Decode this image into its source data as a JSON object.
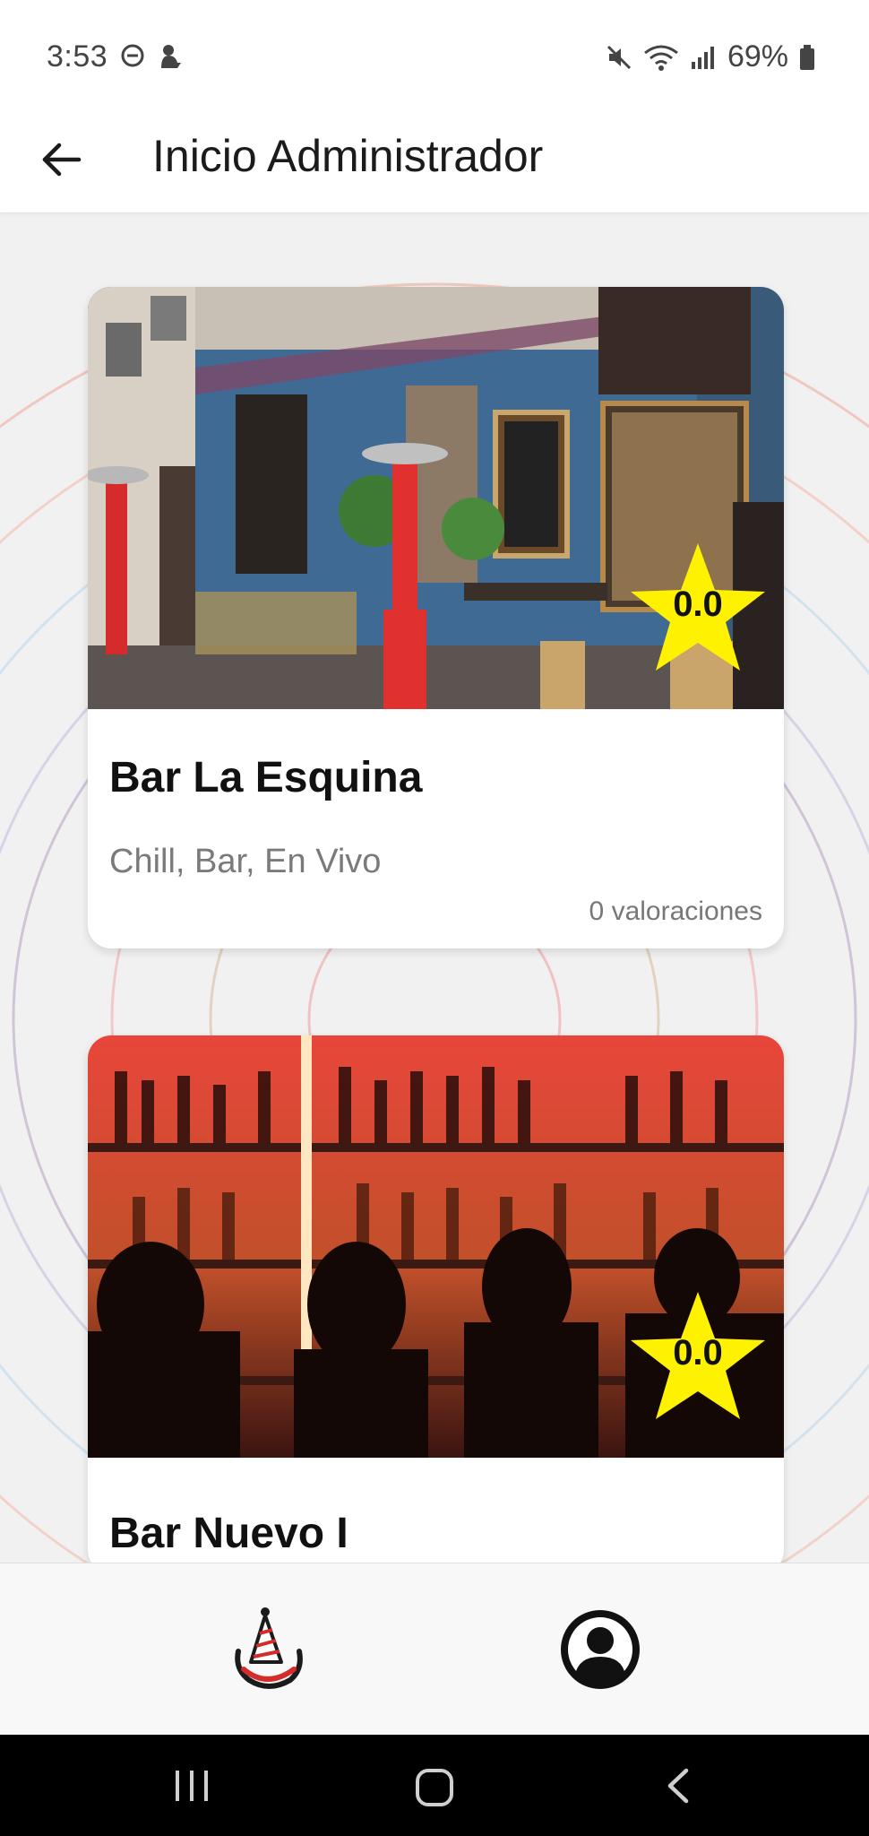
{
  "status_bar": {
    "time": "3:53",
    "battery": "69%",
    "icons": [
      "dnd-icon",
      "notification-icon",
      "mute-icon",
      "wifi-icon",
      "signal-icon",
      "battery-icon"
    ]
  },
  "app_bar": {
    "title": "Inicio Administrador",
    "back_icon": "arrow-left-icon"
  },
  "venues": [
    {
      "name": "Bar La Esquina",
      "tags": "Chill, Bar, En Vivo",
      "rating": "0.0",
      "reviews": "0 valoraciones"
    },
    {
      "name": "Bar Nuevo I",
      "rating": "0.0"
    }
  ],
  "bottom_nav": {
    "items": [
      "party-logo-icon",
      "profile-icon"
    ]
  },
  "system_nav": [
    "recent-apps-icon",
    "home-icon",
    "back-icon"
  ],
  "colors": {
    "star": "#fff200",
    "accent_red": "#d62b2b",
    "text_primary": "#111111",
    "text_secondary": "#7a7a7a"
  }
}
